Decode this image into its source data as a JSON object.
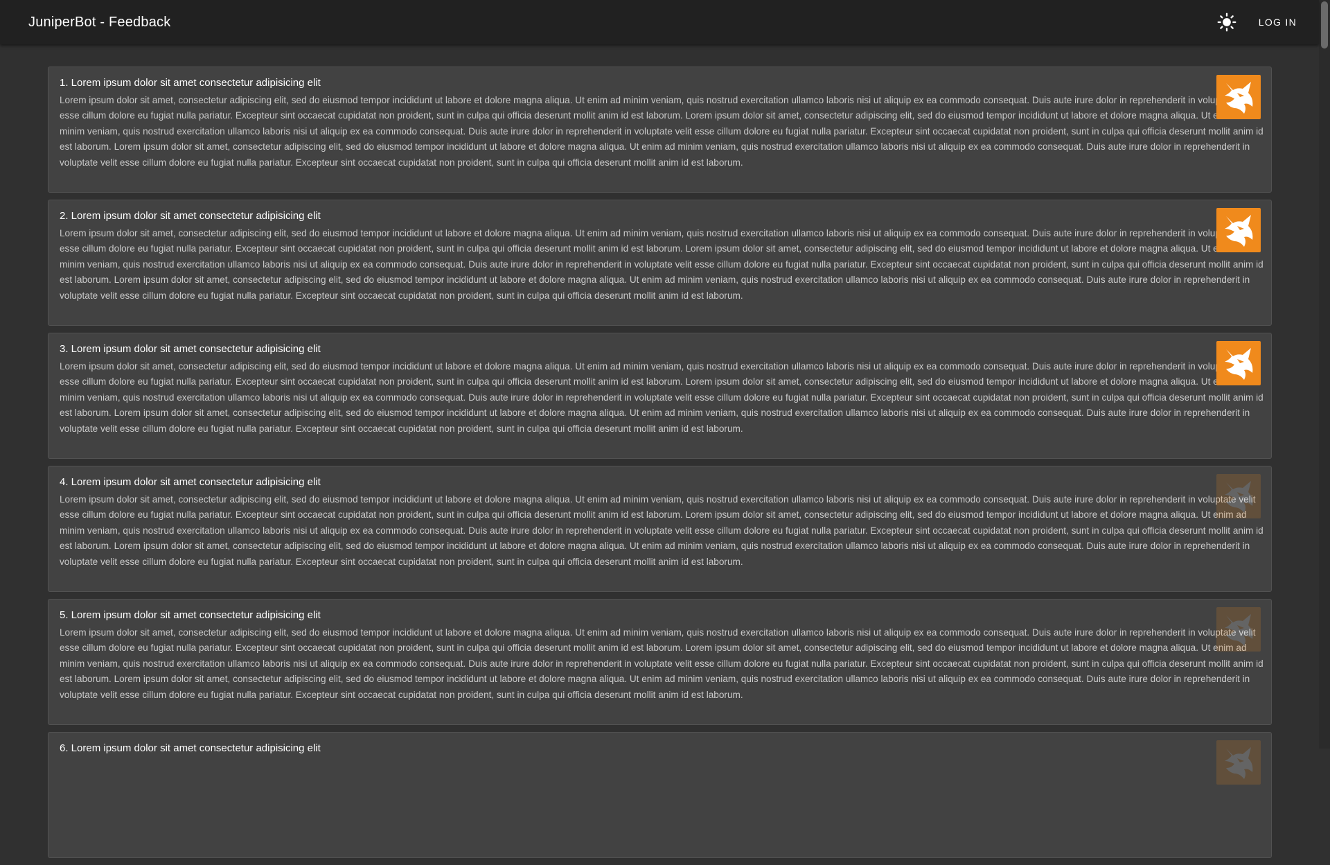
{
  "app": {
    "title": "JuniperBot - Feedback"
  },
  "toolbar": {
    "theme_icon": "sun-icon",
    "login_label": "LOG IN"
  },
  "colors": {
    "background": "#303030",
    "appbar": "#212121",
    "card": "#424242",
    "avatar_orange": "#f08a1c"
  },
  "feedback": [
    {
      "title": "1. Lorem ipsum dolor sit amet consectetur adipisicing elit",
      "body": "Lorem ipsum dolor sit amet, consectetur adipiscing elit, sed do eiusmod tempor incididunt ut labore et dolore magna aliqua. Ut enim ad minim veniam, quis nostrud exercitation ullamco laboris nisi ut aliquip ex ea commodo consequat. Duis aute irure dolor in reprehenderit in voluptate velit esse cillum dolore eu fugiat nulla pariatur. Excepteur sint occaecat cupidatat non proident, sunt in culpa qui officia deserunt mollit anim id est laborum. Lorem ipsum dolor sit amet, consectetur adipiscing elit, sed do eiusmod tempor incididunt ut labore et dolore magna aliqua. Ut enim ad minim veniam, quis nostrud exercitation ullamco laboris nisi ut aliquip ex ea commodo consequat. Duis aute irure dolor in reprehenderit in voluptate velit esse cillum dolore eu fugiat nulla pariatur. Excepteur sint occaecat cupidatat non proident, sunt in culpa qui officia deserunt mollit anim id est laborum. Lorem ipsum dolor sit amet, consectetur adipiscing elit, sed do eiusmod tempor incididunt ut labore et dolore magna aliqua. Ut enim ad minim veniam, quis nostrud exercitation ullamco laboris nisi ut aliquip ex ea commodo consequat. Duis aute irure dolor in reprehenderit in voluptate velit esse cillum dolore eu fugiat nulla pariatur. Excepteur sint occaecat cupidatat non proident, sunt in culpa qui officia deserunt mollit anim id est laborum.",
      "avatar_icon": "fox-logo-icon",
      "avatar_faded": false
    },
    {
      "title": "2. Lorem ipsum dolor sit amet consectetur adipisicing elit",
      "body": "Lorem ipsum dolor sit amet, consectetur adipiscing elit, sed do eiusmod tempor incididunt ut labore et dolore magna aliqua. Ut enim ad minim veniam, quis nostrud exercitation ullamco laboris nisi ut aliquip ex ea commodo consequat. Duis aute irure dolor in reprehenderit in voluptate velit esse cillum dolore eu fugiat nulla pariatur. Excepteur sint occaecat cupidatat non proident, sunt in culpa qui officia deserunt mollit anim id est laborum. Lorem ipsum dolor sit amet, consectetur adipiscing elit, sed do eiusmod tempor incididunt ut labore et dolore magna aliqua. Ut enim ad minim veniam, quis nostrud exercitation ullamco laboris nisi ut aliquip ex ea commodo consequat. Duis aute irure dolor in reprehenderit in voluptate velit esse cillum dolore eu fugiat nulla pariatur. Excepteur sint occaecat cupidatat non proident, sunt in culpa qui officia deserunt mollit anim id est laborum. Lorem ipsum dolor sit amet, consectetur adipiscing elit, sed do eiusmod tempor incididunt ut labore et dolore magna aliqua. Ut enim ad minim veniam, quis nostrud exercitation ullamco laboris nisi ut aliquip ex ea commodo consequat. Duis aute irure dolor in reprehenderit in voluptate velit esse cillum dolore eu fugiat nulla pariatur. Excepteur sint occaecat cupidatat non proident, sunt in culpa qui officia deserunt mollit anim id est laborum.",
      "avatar_icon": "fox-logo-icon",
      "avatar_faded": false
    },
    {
      "title": "3. Lorem ipsum dolor sit amet consectetur adipisicing elit",
      "body": "Lorem ipsum dolor sit amet, consectetur adipiscing elit, sed do eiusmod tempor incididunt ut labore et dolore magna aliqua. Ut enim ad minim veniam, quis nostrud exercitation ullamco laboris nisi ut aliquip ex ea commodo consequat. Duis aute irure dolor in reprehenderit in voluptate velit esse cillum dolore eu fugiat nulla pariatur. Excepteur sint occaecat cupidatat non proident, sunt in culpa qui officia deserunt mollit anim id est laborum. Lorem ipsum dolor sit amet, consectetur adipiscing elit, sed do eiusmod tempor incididunt ut labore et dolore magna aliqua. Ut enim ad minim veniam, quis nostrud exercitation ullamco laboris nisi ut aliquip ex ea commodo consequat. Duis aute irure dolor in reprehenderit in voluptate velit esse cillum dolore eu fugiat nulla pariatur. Excepteur sint occaecat cupidatat non proident, sunt in culpa qui officia deserunt mollit anim id est laborum. Lorem ipsum dolor sit amet, consectetur adipiscing elit, sed do eiusmod tempor incididunt ut labore et dolore magna aliqua. Ut enim ad minim veniam, quis nostrud exercitation ullamco laboris nisi ut aliquip ex ea commodo consequat. Duis aute irure dolor in reprehenderit in voluptate velit esse cillum dolore eu fugiat nulla pariatur. Excepteur sint occaecat cupidatat non proident, sunt in culpa qui officia deserunt mollit anim id est laborum.",
      "avatar_icon": "fox-logo-icon",
      "avatar_faded": false
    },
    {
      "title": "4. Lorem ipsum dolor sit amet consectetur adipisicing elit",
      "body": "Lorem ipsum dolor sit amet, consectetur adipiscing elit, sed do eiusmod tempor incididunt ut labore et dolore magna aliqua. Ut enim ad minim veniam, quis nostrud exercitation ullamco laboris nisi ut aliquip ex ea commodo consequat. Duis aute irure dolor in reprehenderit in voluptate velit esse cillum dolore eu fugiat nulla pariatur. Excepteur sint occaecat cupidatat non proident, sunt in culpa qui officia deserunt mollit anim id est laborum. Lorem ipsum dolor sit amet, consectetur adipiscing elit, sed do eiusmod tempor incididunt ut labore et dolore magna aliqua. Ut enim ad minim veniam, quis nostrud exercitation ullamco laboris nisi ut aliquip ex ea commodo consequat. Duis aute irure dolor in reprehenderit in voluptate velit esse cillum dolore eu fugiat nulla pariatur. Excepteur sint occaecat cupidatat non proident, sunt in culpa qui officia deserunt mollit anim id est laborum. Lorem ipsum dolor sit amet, consectetur adipiscing elit, sed do eiusmod tempor incididunt ut labore et dolore magna aliqua. Ut enim ad minim veniam, quis nostrud exercitation ullamco laboris nisi ut aliquip ex ea commodo consequat. Duis aute irure dolor in reprehenderit in voluptate velit esse cillum dolore eu fugiat nulla pariatur. Excepteur sint occaecat cupidatat non proident, sunt in culpa qui officia deserunt mollit anim id est laborum.",
      "avatar_icon": "fox-logo-icon",
      "avatar_faded": true
    },
    {
      "title": "5. Lorem ipsum dolor sit amet consectetur adipisicing elit",
      "body": "Lorem ipsum dolor sit amet, consectetur adipiscing elit, sed do eiusmod tempor incididunt ut labore et dolore magna aliqua. Ut enim ad minim veniam, quis nostrud exercitation ullamco laboris nisi ut aliquip ex ea commodo consequat. Duis aute irure dolor in reprehenderit in voluptate velit esse cillum dolore eu fugiat nulla pariatur. Excepteur sint occaecat cupidatat non proident, sunt in culpa qui officia deserunt mollit anim id est laborum. Lorem ipsum dolor sit amet, consectetur adipiscing elit, sed do eiusmod tempor incididunt ut labore et dolore magna aliqua. Ut enim ad minim veniam, quis nostrud exercitation ullamco laboris nisi ut aliquip ex ea commodo consequat. Duis aute irure dolor in reprehenderit in voluptate velit esse cillum dolore eu fugiat nulla pariatur. Excepteur sint occaecat cupidatat non proident, sunt in culpa qui officia deserunt mollit anim id est laborum. Lorem ipsum dolor sit amet, consectetur adipiscing elit, sed do eiusmod tempor incididunt ut labore et dolore magna aliqua. Ut enim ad minim veniam, quis nostrud exercitation ullamco laboris nisi ut aliquip ex ea commodo consequat. Duis aute irure dolor in reprehenderit in voluptate velit esse cillum dolore eu fugiat nulla pariatur. Excepteur sint occaecat cupidatat non proident, sunt in culpa qui officia deserunt mollit anim id est laborum.",
      "avatar_icon": "fox-logo-icon",
      "avatar_faded": true
    },
    {
      "title": "6. Lorem ipsum dolor sit amet consectetur adipisicing elit",
      "body": "",
      "avatar_icon": "fox-logo-icon",
      "avatar_faded": true
    }
  ]
}
